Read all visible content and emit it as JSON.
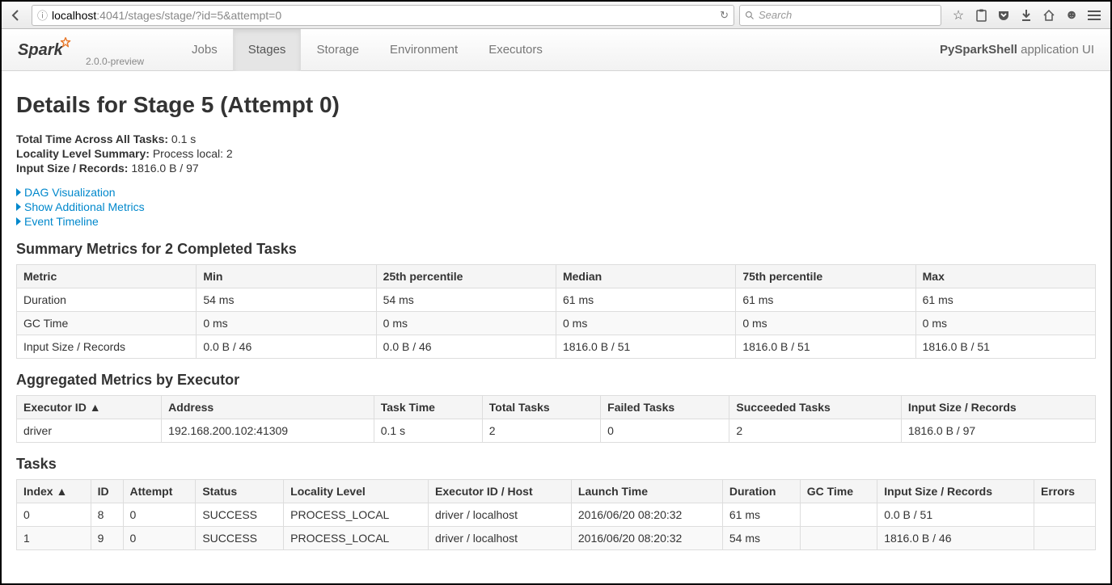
{
  "browser": {
    "url_host": "localhost",
    "url_rest": ":4041/stages/stage/?id=5&attempt=0",
    "search_placeholder": "Search"
  },
  "navbar": {
    "version": "2.0.0-preview",
    "tabs": [
      {
        "label": "Jobs"
      },
      {
        "label": "Stages"
      },
      {
        "label": "Storage"
      },
      {
        "label": "Environment"
      },
      {
        "label": "Executors"
      }
    ],
    "app_name": "PySparkShell",
    "app_suffix": " application UI"
  },
  "page": {
    "title": "Details for Stage 5 (Attempt 0)",
    "meta": {
      "total_time_label": "Total Time Across All Tasks:",
      "total_time_value": "0.1 s",
      "locality_label": "Locality Level Summary:",
      "locality_value": "Process local: 2",
      "input_label": "Input Size / Records:",
      "input_value": "1816.0 B / 97"
    },
    "expanders": {
      "dag": "DAG Visualization",
      "metrics": "Show Additional Metrics",
      "timeline": "Event Timeline"
    }
  },
  "summary": {
    "title": "Summary Metrics for 2 Completed Tasks",
    "headers": [
      "Metric",
      "Min",
      "25th percentile",
      "Median",
      "75th percentile",
      "Max"
    ],
    "rows": [
      [
        "Duration",
        "54 ms",
        "54 ms",
        "61 ms",
        "61 ms",
        "61 ms"
      ],
      [
        "GC Time",
        "0 ms",
        "0 ms",
        "0 ms",
        "0 ms",
        "0 ms"
      ],
      [
        "Input Size / Records",
        "0.0 B / 46",
        "0.0 B / 46",
        "1816.0 B / 51",
        "1816.0 B / 51",
        "1816.0 B / 51"
      ]
    ]
  },
  "aggregated": {
    "title": "Aggregated Metrics by Executor",
    "headers": [
      "Executor ID ▲",
      "Address",
      "Task Time",
      "Total Tasks",
      "Failed Tasks",
      "Succeeded Tasks",
      "Input Size / Records"
    ],
    "rows": [
      [
        "driver",
        "192.168.200.102:41309",
        "0.1 s",
        "2",
        "0",
        "2",
        "1816.0 B / 97"
      ]
    ]
  },
  "tasks": {
    "title": "Tasks",
    "headers": [
      "Index ▲",
      "ID",
      "Attempt",
      "Status",
      "Locality Level",
      "Executor ID / Host",
      "Launch Time",
      "Duration",
      "GC Time",
      "Input Size / Records",
      "Errors"
    ],
    "rows": [
      [
        "0",
        "8",
        "0",
        "SUCCESS",
        "PROCESS_LOCAL",
        "driver / localhost",
        "2016/06/20 08:20:32",
        "61 ms",
        "",
        "0.0 B / 51",
        ""
      ],
      [
        "1",
        "9",
        "0",
        "SUCCESS",
        "PROCESS_LOCAL",
        "driver / localhost",
        "2016/06/20 08:20:32",
        "54 ms",
        "",
        "1816.0 B / 46",
        ""
      ]
    ]
  }
}
